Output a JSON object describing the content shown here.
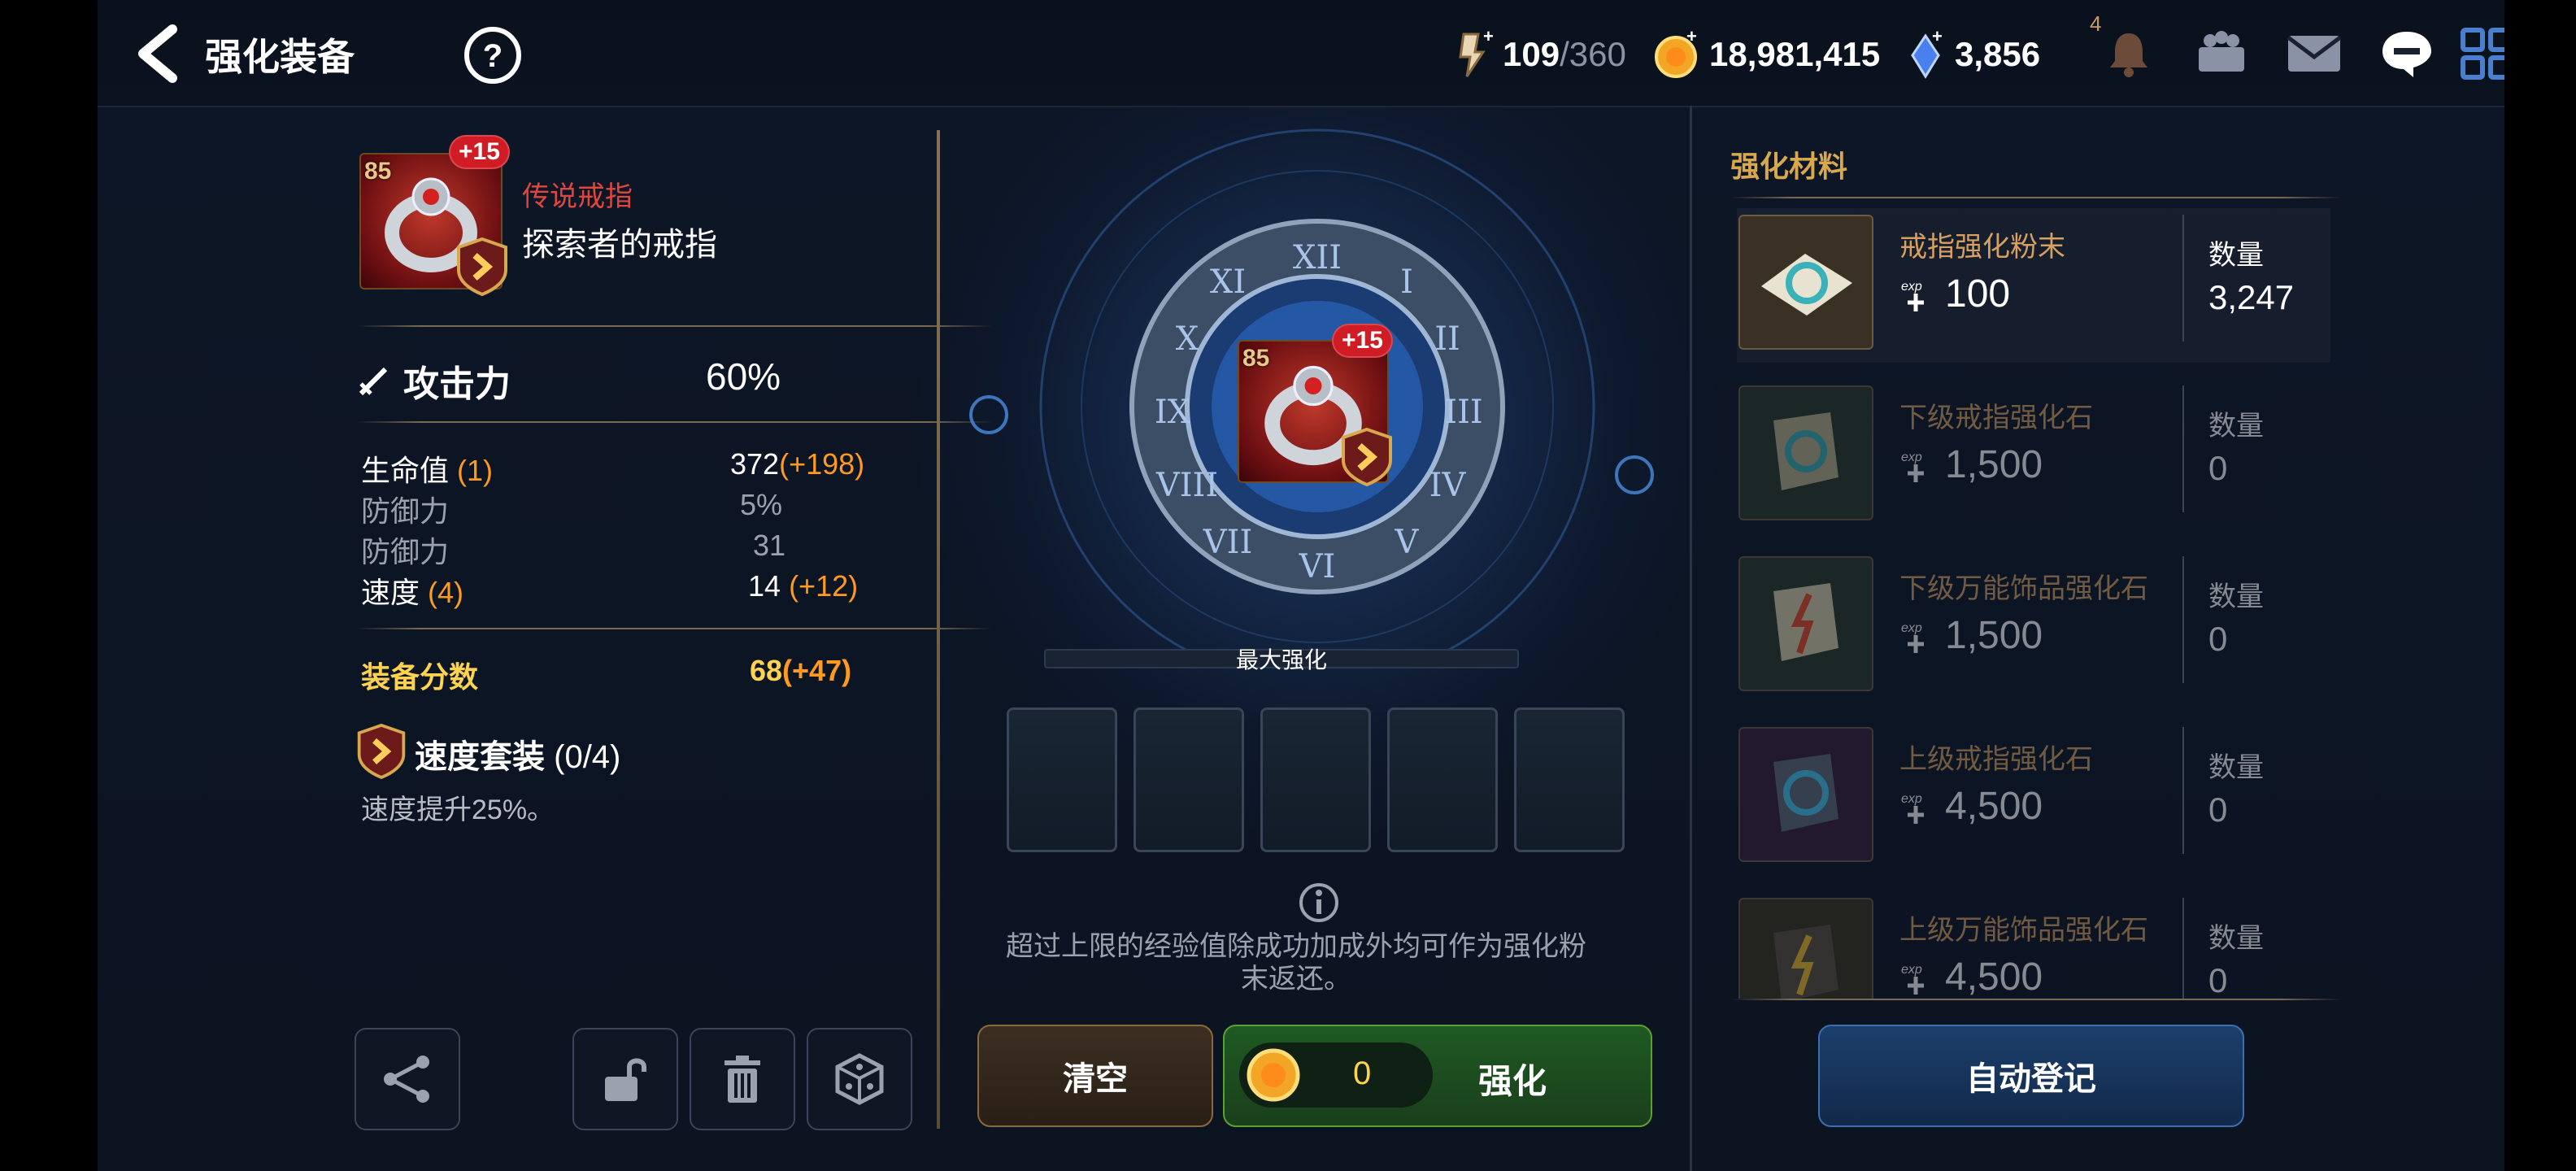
{
  "header": {
    "title": "强化装备",
    "stamina_value": "109",
    "stamina_max": "/360",
    "gold": "18,981,415",
    "crystal": "3,856",
    "notification_count": "4"
  },
  "item": {
    "level": "85",
    "plus": "+15",
    "rarity": "传说戒指",
    "name": "探索者的戒指"
  },
  "main_stat": {
    "label": "攻击力",
    "value": "60%"
  },
  "sub_stats": [
    {
      "label": "生命值",
      "roll": "(1)",
      "value": "372",
      "bonus": "(+198)"
    },
    {
      "label": "防御力",
      "roll": "",
      "value": "5%",
      "bonus": ""
    },
    {
      "label": "防御力",
      "roll": "",
      "value": "31",
      "bonus": ""
    },
    {
      "label": "速度",
      "roll": "(4)",
      "value": "14",
      "bonus": "(+12)"
    }
  ],
  "gear_score": {
    "label": "装备分数",
    "value": "68",
    "bonus": "(+47)"
  },
  "set": {
    "name": "速度套装",
    "count": "(0/4)",
    "desc": "速度提升25%。"
  },
  "center": {
    "max_label": "最大强化",
    "note": "超过上限的经验值除成功加成外均可作为强化粉末返还。",
    "clear_label": "清空",
    "enhance_label": "强化",
    "cost": "0"
  },
  "materials": {
    "title": "强化材料",
    "qty_label": "数量",
    "items": [
      {
        "name": "戒指强化粉末",
        "exp": "100",
        "qty": "3,247"
      },
      {
        "name": "下级戒指强化石",
        "exp": "1,500",
        "qty": "0"
      },
      {
        "name": "下级万能饰品强化石",
        "exp": "1,500",
        "qty": "0"
      },
      {
        "name": "上级戒指强化石",
        "exp": "4,500",
        "qty": "0"
      },
      {
        "name": "上级万能饰品强化石",
        "exp": "4,500",
        "qty": "0"
      }
    ],
    "auto_label": "自动登记"
  },
  "colors": {
    "accent_gold": "#ffd34e",
    "bonus_orange": "#ff9a1f",
    "rarity_red": "#e0463e",
    "enhance_green": "#1f5a22"
  }
}
